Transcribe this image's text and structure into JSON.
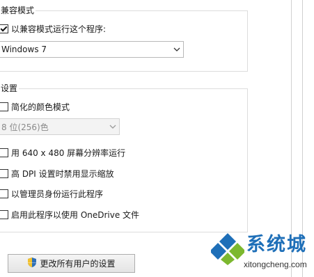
{
  "compat_mode": {
    "title": "兼容模式",
    "checkbox_label": "以兼容模式运行这个程序:",
    "checked": true,
    "os_select_value": "Windows 7"
  },
  "settings": {
    "title": "设置",
    "reduced_color": {
      "label": "简化的颜色模式",
      "checked": false
    },
    "color_select_value": "8 位(256)色",
    "options": [
      {
        "label": "用 640 x 480 屏幕分辨率运行",
        "checked": false
      },
      {
        "label": "高 DPI 设置时禁用显示缩放",
        "checked": false
      },
      {
        "label": "以管理员身份运行此程序",
        "checked": false
      },
      {
        "label": "启用此程序以使用 OneDrive 文件",
        "checked": false
      }
    ]
  },
  "change_all_users_button": "更改所有用户的设置",
  "icons": {
    "shield": "uac-shield-icon",
    "dropdown": "chevron-down-icon"
  },
  "watermark": {
    "brand": "系统城",
    "url": "xitongcheng.com"
  },
  "colors": {
    "shield_blue": "#2f6fb6",
    "shield_yellow": "#f2c12e",
    "watermark_blue": "#1e6fb8",
    "watermark_green": "#7cb82f"
  }
}
